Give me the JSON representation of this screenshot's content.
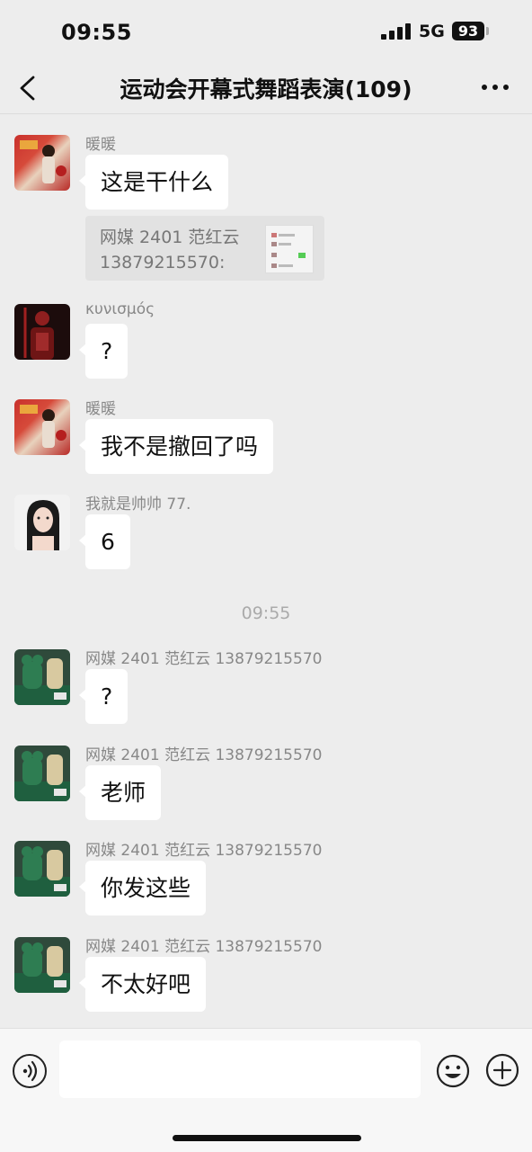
{
  "status_bar": {
    "time": "09:55",
    "network": "5G",
    "battery": "93"
  },
  "nav": {
    "title": "运动会开幕式舞蹈表演(109)"
  },
  "messages": [
    {
      "sender": "暖暖",
      "text": "这是干什么",
      "avatar": "red-photo-avatar",
      "quote": {
        "text": "网媒 2401 范红云 13879215570:"
      }
    },
    {
      "sender": "κυνισμός",
      "text": "?",
      "avatar": "dark-red-figure-avatar"
    },
    {
      "sender": "暖暖",
      "text": "我不是撤回了吗",
      "avatar": "red-photo-avatar"
    },
    {
      "sender": "我就是帅帅 77.",
      "text": "6",
      "avatar": "girl-portrait-avatar"
    },
    {
      "sender": "网媒 2401 范红云 13879215570",
      "text": "?",
      "avatar": "green-bear-avatar"
    },
    {
      "sender": "网媒 2401 范红云 13879215570",
      "text": "老师",
      "avatar": "green-bear-avatar"
    },
    {
      "sender": "网媒 2401 范红云 13879215570",
      "text": "你发这些",
      "avatar": "green-bear-avatar"
    },
    {
      "sender": "网媒 2401 范红云 13879215570",
      "text": "不太好吧",
      "avatar": "green-bear-avatar"
    }
  ],
  "timestamp": "09:55",
  "icons": {
    "back": "chevron-left-icon",
    "more": "more-dots-icon",
    "voice": "voice-icon",
    "emoji": "emoji-icon",
    "plus": "plus-icon"
  },
  "colors": {
    "background": "#ededed",
    "bubble": "#ffffff",
    "quote": "#e2e2e2",
    "input_bar": "#f7f7f7"
  }
}
